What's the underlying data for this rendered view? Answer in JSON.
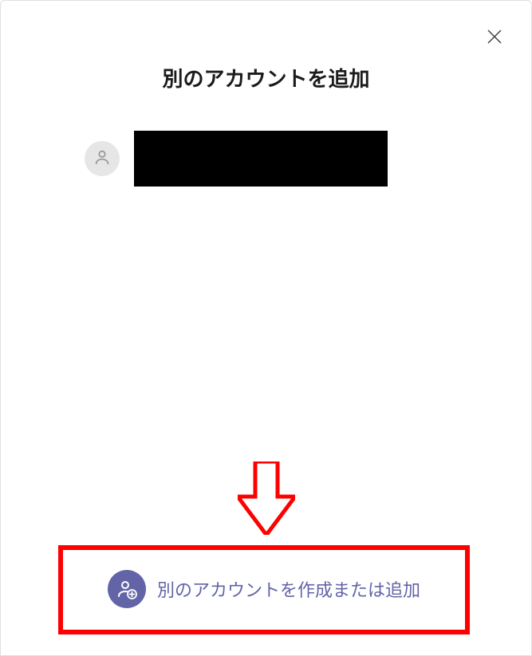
{
  "modal": {
    "title": "別のアカウントを追加",
    "account": {
      "display": ""
    },
    "addButton": {
      "label": "別のアカウントを作成または追加"
    }
  },
  "colors": {
    "accent": "#6264a7",
    "annotation": "#ff0000"
  }
}
